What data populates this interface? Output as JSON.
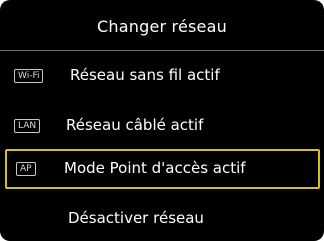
{
  "screen": {
    "title": "Changer réseau",
    "accent_color": "#d4c21a",
    "background_color": "#000000"
  },
  "menu": {
    "items": [
      {
        "icon": "wifi-badge-icon",
        "badge": "Wi-Fi",
        "label": "Réseau sans fil actif",
        "selected": false
      },
      {
        "icon": "lan-badge-icon",
        "badge": "LAN",
        "label": "Réseau câblé actif",
        "selected": false
      },
      {
        "icon": "ap-badge-icon",
        "badge": "AP",
        "label": "Mode Point d'accès actif",
        "selected": true
      },
      {
        "icon": "",
        "badge": "",
        "label": "Désactiver réseau",
        "selected": false
      }
    ]
  }
}
